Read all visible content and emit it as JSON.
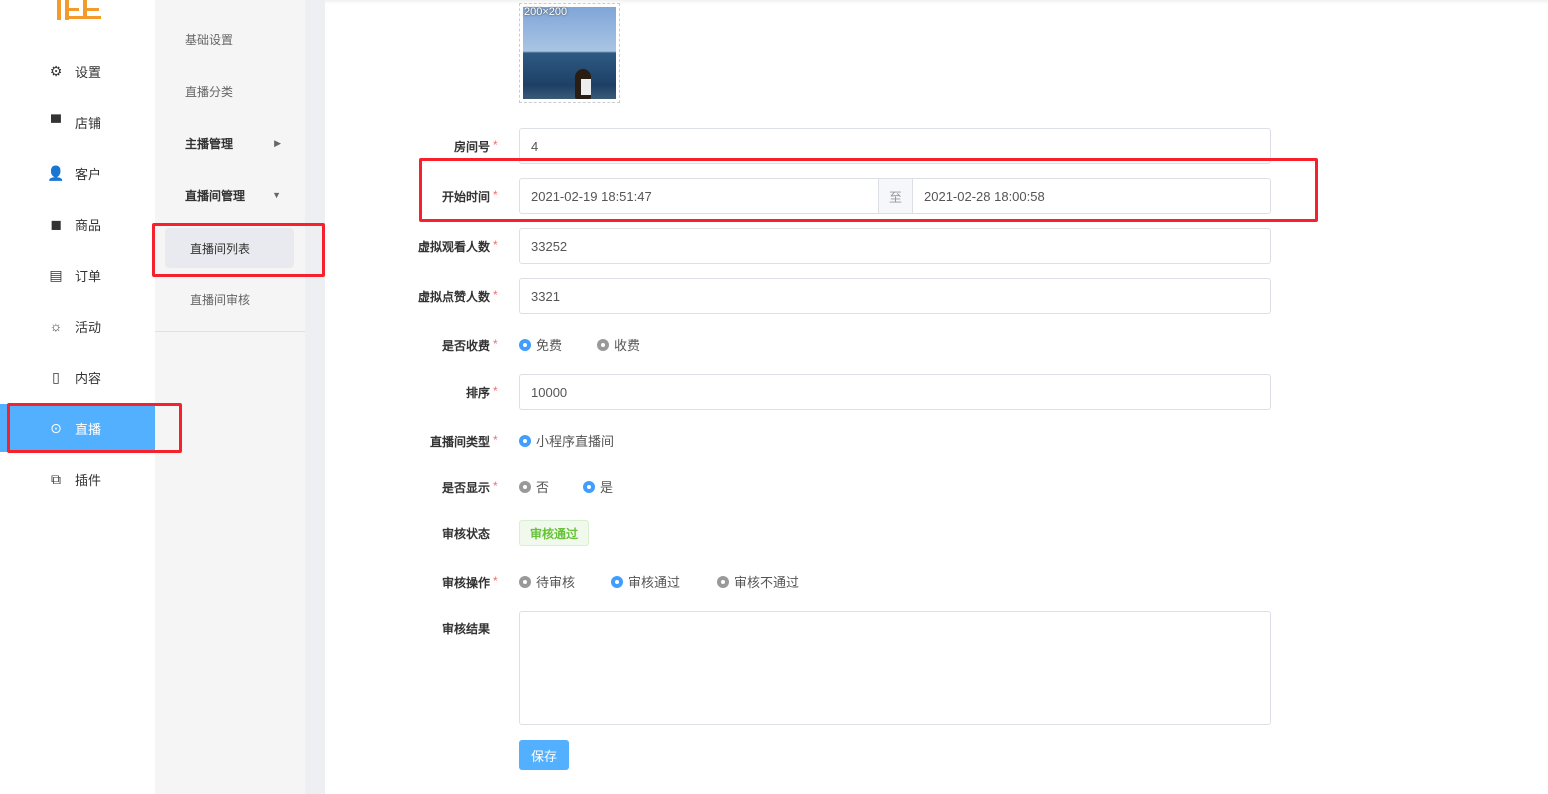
{
  "nav": {
    "items": [
      {
        "label": "设置",
        "icon": "gear-icon"
      },
      {
        "label": "店铺",
        "icon": "store-icon"
      },
      {
        "label": "客户",
        "icon": "user-icon"
      },
      {
        "label": "商品",
        "icon": "bag-icon"
      },
      {
        "label": "订单",
        "icon": "clipboard-icon"
      },
      {
        "label": "活动",
        "icon": "sun-icon"
      },
      {
        "label": "内容",
        "icon": "notebook-icon"
      },
      {
        "label": "直播",
        "icon": "play-circle-icon"
      },
      {
        "label": "插件",
        "icon": "puzzle-icon"
      }
    ],
    "active": "直播"
  },
  "submenu": {
    "items": [
      "基础设置",
      "直播分类",
      "主播管理",
      "直播间管理",
      "直播间列表",
      "直播间审核"
    ],
    "selected": "直播间列表"
  },
  "form": {
    "image_size": "200×200",
    "room_no": {
      "label": "房间号",
      "value": "4"
    },
    "start_time": {
      "label": "开始时间",
      "start": "2021-02-19 18:51:47",
      "separator": "至",
      "end": "2021-02-28 18:00:58"
    },
    "viewers": {
      "label": "虚拟观看人数",
      "value": "33252"
    },
    "likes": {
      "label": "虚拟点赞人数",
      "value": "3321"
    },
    "fee": {
      "label": "是否收费",
      "options": [
        "免费",
        "收费"
      ],
      "selected": "免费"
    },
    "sort": {
      "label": "排序",
      "value": "10000"
    },
    "room_type": {
      "label": "直播间类型",
      "options": [
        "小程序直播间"
      ],
      "selected": "小程序直播间"
    },
    "show": {
      "label": "是否显示",
      "options": [
        "否",
        "是"
      ],
      "selected": "是"
    },
    "audit_status": {
      "label": "审核状态",
      "value": "审核通过"
    },
    "audit_action": {
      "label": "审核操作",
      "options": [
        "待审核",
        "审核通过",
        "审核不通过"
      ],
      "selected": "审核通过"
    },
    "audit_result": {
      "label": "审核结果",
      "value": ""
    },
    "required_mark": "*",
    "save_label": "保存"
  },
  "colors": {
    "accent": "#52b0ff",
    "radio": "#409eff",
    "success": "#67c23a",
    "highlight": "#f5222d",
    "logo": "#f39a2b"
  }
}
